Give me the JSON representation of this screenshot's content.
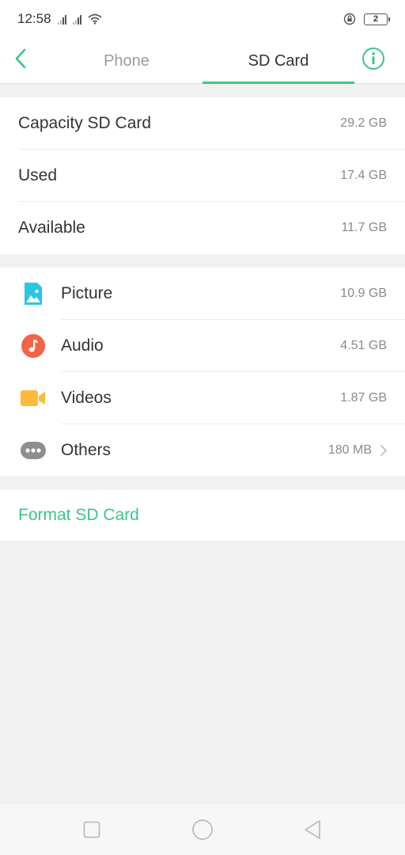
{
  "status_bar": {
    "time": "12:58",
    "battery_level": "2"
  },
  "header": {
    "tabs": [
      {
        "label": "Phone",
        "selected": false
      },
      {
        "label": "SD Card",
        "selected": true
      }
    ],
    "accent_color": "#3cc68a"
  },
  "storage_summary": [
    {
      "label": "Capacity SD Card",
      "value": "29.2 GB"
    },
    {
      "label": "Used",
      "value": "17.4 GB"
    },
    {
      "label": "Available",
      "value": "11.7 GB"
    }
  ],
  "categories": [
    {
      "label": "Picture",
      "value": "10.9 GB",
      "icon": "picture-icon",
      "color": "#29c6e6"
    },
    {
      "label": "Audio",
      "value": "4.51 GB",
      "icon": "music-note-icon",
      "color": "#f2644a"
    },
    {
      "label": "Videos",
      "value": "1.87 GB",
      "icon": "video-camera-icon",
      "color": "#fcbb3c"
    },
    {
      "label": "Others",
      "value": "180 MB",
      "icon": "more-dots-icon",
      "color": "#8e8e8e"
    }
  ],
  "actions": {
    "format_label": "Format SD Card"
  }
}
